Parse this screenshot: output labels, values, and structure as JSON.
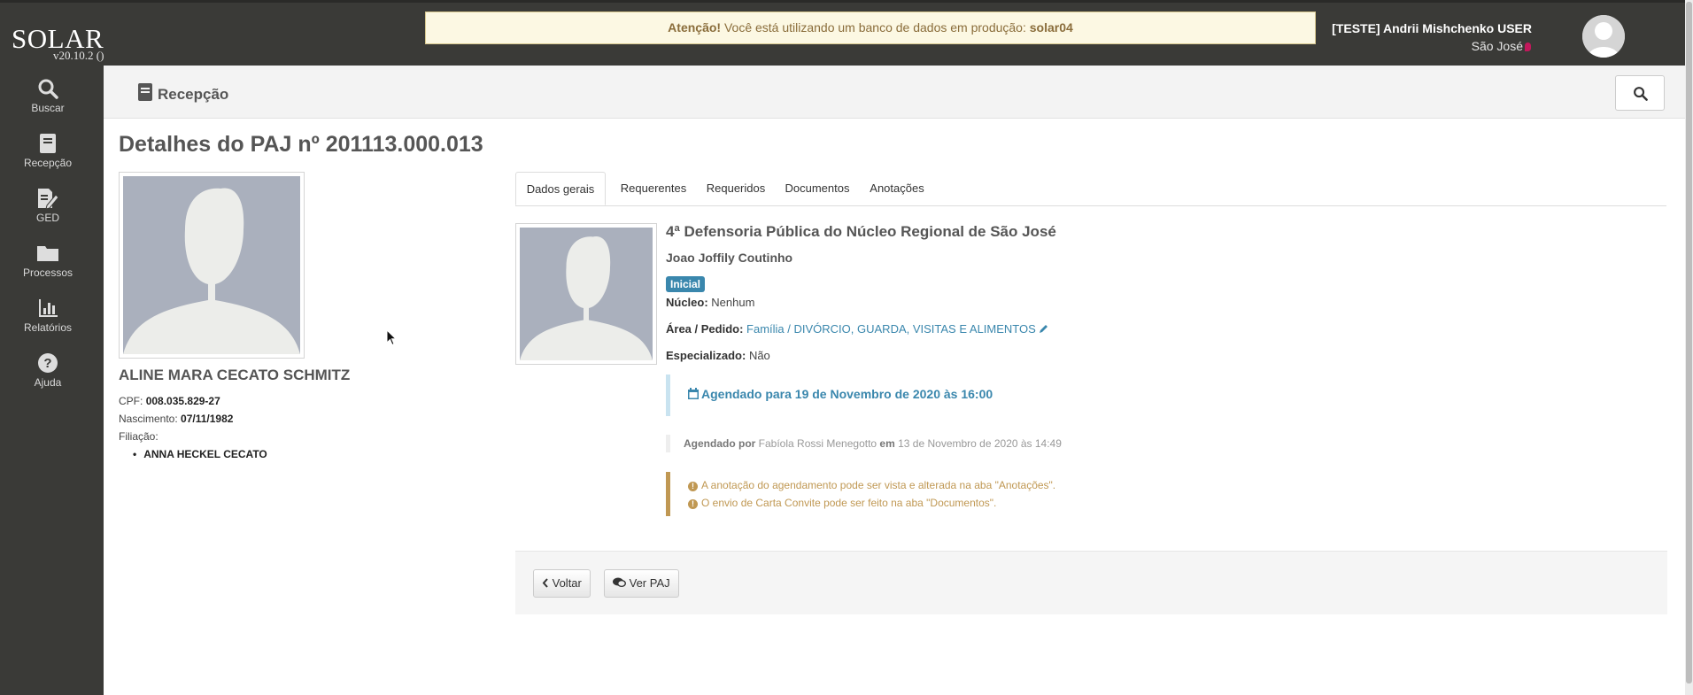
{
  "app": {
    "brand": "SOLAR",
    "version": "v20.10.2 ()"
  },
  "alert": {
    "prefix": "Atenção!",
    "message": " Você está utilizando um banco de dados em produção: ",
    "db": "solar04"
  },
  "user": {
    "name": "[TESTE] Andrii Mishchenko USER",
    "location": "São José"
  },
  "sidebar": {
    "items": [
      {
        "label": "Buscar",
        "icon": "search-icon"
      },
      {
        "label": "Recepção",
        "icon": "book-icon"
      },
      {
        "label": "GED",
        "icon": "edit-doc-icon"
      },
      {
        "label": "Processos",
        "icon": "folder-icon"
      },
      {
        "label": "Relatórios",
        "icon": "bar-chart-icon"
      },
      {
        "label": "Ajuda",
        "icon": "help-icon"
      }
    ]
  },
  "header": {
    "title": "Recepção"
  },
  "page": {
    "title": "Detalhes do PAJ nº 201113.000.013"
  },
  "person": {
    "name": "ALINE MARA CECATO SCHMITZ",
    "cpf_label": "CPF:",
    "cpf": "008.035.829-27",
    "birth_label": "Nascimento:",
    "birth": "07/11/1982",
    "filiacao_label": "Filiação:",
    "filiacao": [
      "ANNA HECKEL CECATO"
    ]
  },
  "tabs": [
    {
      "label": "Dados gerais",
      "active": true
    },
    {
      "label": "Requerentes",
      "active": false
    },
    {
      "label": "Requeridos",
      "active": false
    },
    {
      "label": "Documentos",
      "active": false
    },
    {
      "label": "Anotações",
      "active": false
    }
  ],
  "details": {
    "defensoria": "4ª Defensoria Pública do Núcleo Regional de São José",
    "defensor": "Joao Joffily Coutinho",
    "status_badge": "Inicial",
    "nucleo_label": "Núcleo:",
    "nucleo": "Nenhum",
    "area_label": "Área / Pedido:",
    "area": "Família / DIVÓRCIO, GUARDA, VISITAS E ALIMENTOS",
    "especializado_label": "Especializado:",
    "especializado": "Não",
    "schedule": "Agendado para 19 de Novembro de 2020 às 16:00",
    "booked_by_label": "Agendado por",
    "booked_by": "Fabíola Rossi Menegotto",
    "booked_on_label": "em",
    "booked_on": "13 de Novembro de 2020 às 14:49",
    "notes": [
      "A anotação do agendamento pode ser vista e alterada na aba \"Anotações\".",
      "O envio de Carta Convite pode ser feito na aba \"Documentos\"."
    ]
  },
  "actions": {
    "back": "Voltar",
    "view": "Ver PAJ"
  },
  "colors": {
    "sidebar": "#3a3a37",
    "accent": "#3a87ad",
    "warning": "#c09853",
    "badge": "#3a87ad"
  }
}
